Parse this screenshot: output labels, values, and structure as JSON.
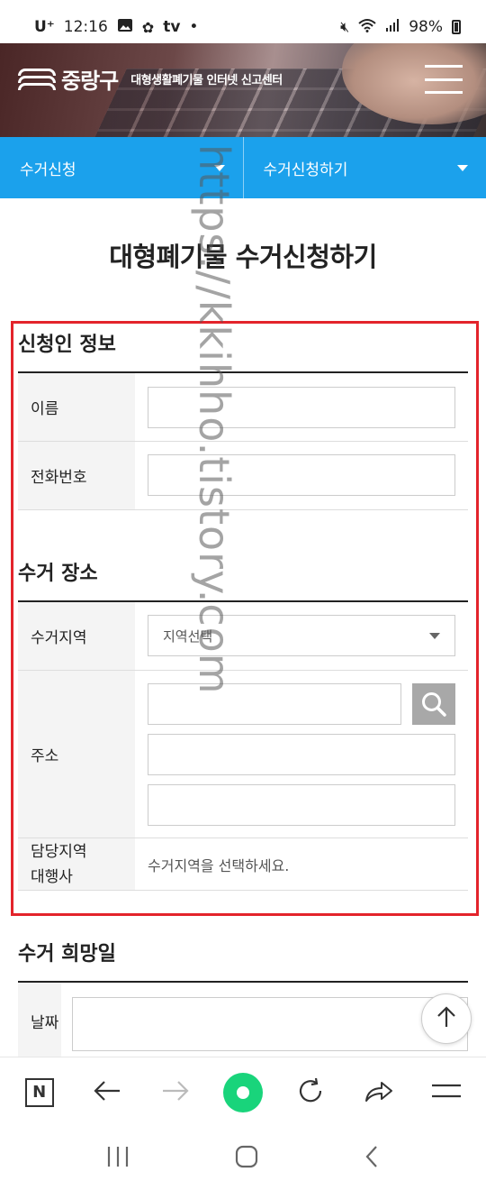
{
  "status_bar": {
    "carrier": "U⁺",
    "time": "12:16",
    "app_icon_tv": "tv",
    "dot": "•",
    "battery": "98%",
    "icons": [
      "image-icon",
      "fan-icon",
      "mute-icon",
      "wifi-icon",
      "signal-icon",
      "battery-icon"
    ]
  },
  "header": {
    "logo_name": "중랑구",
    "logo_sub": "대형생활폐기물 인터넷 신고센터"
  },
  "nav": {
    "menu1": "수거신청",
    "menu2": "수거신청하기"
  },
  "page_title": "대형폐기물 수거신청하기",
  "applicant": {
    "title": "신청인 정보",
    "name_label": "이름",
    "phone_label": "전화번호"
  },
  "location": {
    "title": "수거 장소",
    "area_label": "수거지역",
    "area_select": "지역선택",
    "address_label": "주소",
    "agency_label_line1": "담당지역",
    "agency_label_line2": "대행사",
    "agency_text": "수거지역을 선택하세요."
  },
  "schedule": {
    "title": "수거 희망일",
    "date_label": "날짜"
  },
  "watermark": "https://kkihho.tistory.com",
  "colors": {
    "nav_blue": "#1ba1ec",
    "highlight_red": "#e3242b",
    "green": "#19d47b"
  }
}
